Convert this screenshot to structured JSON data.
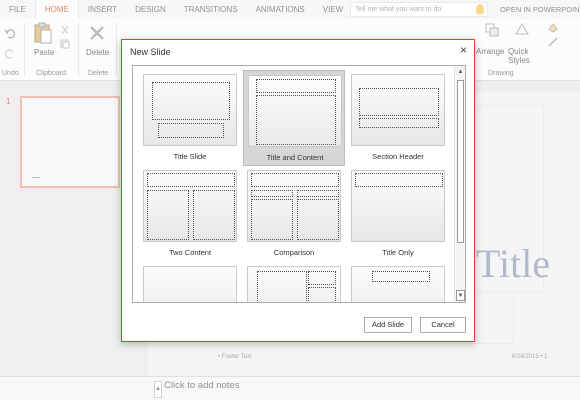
{
  "ribbon": {
    "tabs": [
      "FILE",
      "HOME",
      "INSERT",
      "DESIGN",
      "TRANSITIONS",
      "ANIMATIONS",
      "VIEW"
    ],
    "active_tab": "HOME",
    "tell_me_placeholder": "Tell me what you want to do",
    "open_in_label": "OPEN IN POWERPOINT",
    "paste_label": "Paste",
    "delete_label": "Delete",
    "arrange_label": "Arrange",
    "quick_styles_label": "Quick Styles",
    "groups": {
      "undo": "Undo",
      "clipboard": "Clipboard",
      "delete": "Delete",
      "drawing": "Drawing"
    },
    "accent": "#d24726"
  },
  "thumbnails": {
    "slide_number": "1"
  },
  "slide": {
    "title_partial": "Title",
    "footer_text": "Footer Text",
    "date_text": "6/26/2015 • 1"
  },
  "notes": {
    "placeholder": "Click to add notes"
  },
  "dialog": {
    "title": "New Slide",
    "close_icon": "close-icon",
    "layouts": [
      {
        "label": "Title Slide"
      },
      {
        "label": "Title and Content",
        "selected": true
      },
      {
        "label": "Section Header"
      },
      {
        "label": "Two Content"
      },
      {
        "label": "Comparison"
      },
      {
        "label": "Title Only"
      },
      {
        "label": ""
      },
      {
        "label": ""
      },
      {
        "label": ""
      }
    ],
    "add_button": "Add Slide",
    "cancel_button": "Cancel"
  }
}
